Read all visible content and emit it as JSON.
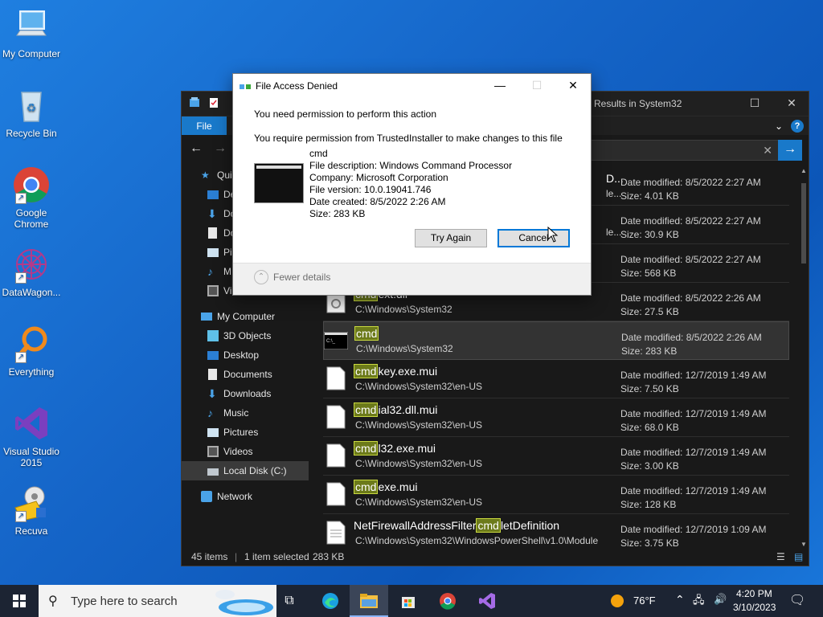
{
  "desktop": {
    "icons": [
      {
        "label": "My Computer",
        "icon": "computer-icon"
      },
      {
        "label": "Recycle Bin",
        "icon": "recycle-bin-icon"
      },
      {
        "label": "Google Chrome",
        "icon": "chrome-icon"
      },
      {
        "label": "DataWagon...",
        "icon": "datawagon-icon"
      },
      {
        "label": "Everything",
        "icon": "everything-search-icon"
      },
      {
        "label": "Visual Studio 2015",
        "icon": "visual-studio-icon"
      },
      {
        "label": "Recuva",
        "icon": "recuva-icon"
      }
    ]
  },
  "explorer": {
    "title": "Results in System32",
    "file_tab": "File",
    "nav": {
      "quick": "Qui",
      "quick_items": [
        "De",
        "Do",
        "Do",
        "Pi",
        "M",
        "Videos"
      ],
      "my_computer": "My Computer",
      "computer_items": [
        "3D Objects",
        "Desktop",
        "Documents",
        "Downloads",
        "Music",
        "Pictures",
        "Videos",
        "Local Disk (C:)"
      ],
      "network": "Network"
    },
    "files": [
      {
        "pre": "",
        "hl": "",
        "post": "D...",
        "path": "le...",
        "date": "Date modified: 8/5/2022 2:27 AM",
        "size": "Size: 4.01 KB"
      },
      {
        "pre": "",
        "hl": "",
        "post": "",
        "path": "le...",
        "date": "Date modified: 8/5/2022 2:27 AM",
        "size": "Size: 30.9 KB"
      },
      {
        "pre": "",
        "hl": "",
        "post": "",
        "path": "",
        "date": "Date modified: 8/5/2022 2:27 AM",
        "size": "Size: 568 KB"
      },
      {
        "pre": "",
        "hl": "cmd",
        "post": "ext.dll",
        "path": "C:\\Windows\\System32",
        "date": "Date modified: 8/5/2022 2:26 AM",
        "size": "Size: 27.5 KB"
      },
      {
        "pre": "",
        "hl": "cmd",
        "post": "",
        "path": "C:\\Windows\\System32",
        "date": "Date modified: 8/5/2022 2:26 AM",
        "size": "Size: 283 KB"
      },
      {
        "pre": "",
        "hl": "cmd",
        "post": "key.exe.mui",
        "path": "C:\\Windows\\System32\\en-US",
        "date": "Date modified: 12/7/2019 1:49 AM",
        "size": "Size: 7.50 KB"
      },
      {
        "pre": "",
        "hl": "cmd",
        "post": "ial32.dll.mui",
        "path": "C:\\Windows\\System32\\en-US",
        "date": "Date modified: 12/7/2019 1:49 AM",
        "size": "Size: 68.0 KB"
      },
      {
        "pre": "",
        "hl": "cmd",
        "post": "l32.exe.mui",
        "path": "C:\\Windows\\System32\\en-US",
        "date": "Date modified: 12/7/2019 1:49 AM",
        "size": "Size: 3.00 KB"
      },
      {
        "pre": "",
        "hl": "cmd",
        "post": "exe.mui",
        "path": "C:\\Windows\\System32\\en-US",
        "date": "Date modified: 12/7/2019 1:49 AM",
        "size": "Size: 128 KB"
      },
      {
        "pre": "NetFirewallAddressFilter",
        "hl": "cmd",
        "post": "letDefinition",
        "path": "C:\\Windows\\System32\\WindowsPowerShell\\v1.0\\Module",
        "date": "Date modified: 12/7/2019 1:09 AM",
        "size": "Size: 3.75 KB"
      }
    ],
    "status": {
      "items": "45 items",
      "selected": "1 item selected",
      "size": "283 KB"
    }
  },
  "dialog": {
    "title": "File Access Denied",
    "heading": "You need permission to perform this action",
    "message": "You require permission from TrustedInstaller to make changes to this file",
    "details": {
      "name": "cmd",
      "description": "File description: Windows Command Processor",
      "company": "Company: Microsoft Corporation",
      "version": "File version: 10.0.19041.746",
      "created": "Date created: 8/5/2022 2:26 AM",
      "size": "Size: 283 KB"
    },
    "try_again": "Try Again",
    "cancel": "Cancel",
    "fewer_details": "Fewer details"
  },
  "taskbar": {
    "search_placeholder": "Type here to search",
    "weather": "76°F",
    "time": "4:20 PM",
    "date": "3/10/2023"
  },
  "colors": {
    "accent": "#1979ca",
    "highlight": "#c9d93f",
    "taskbar": "#1c2433"
  }
}
